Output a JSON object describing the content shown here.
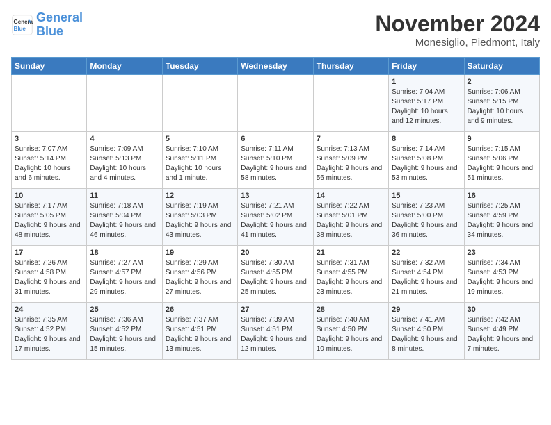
{
  "header": {
    "logo_line1": "General",
    "logo_line2": "Blue",
    "month": "November 2024",
    "location": "Monesiglio, Piedmont, Italy"
  },
  "days_of_week": [
    "Sunday",
    "Monday",
    "Tuesday",
    "Wednesday",
    "Thursday",
    "Friday",
    "Saturday"
  ],
  "weeks": [
    [
      {
        "num": "",
        "info": ""
      },
      {
        "num": "",
        "info": ""
      },
      {
        "num": "",
        "info": ""
      },
      {
        "num": "",
        "info": ""
      },
      {
        "num": "",
        "info": ""
      },
      {
        "num": "1",
        "info": "Sunrise: 7:04 AM\nSunset: 5:17 PM\nDaylight: 10 hours and 12 minutes."
      },
      {
        "num": "2",
        "info": "Sunrise: 7:06 AM\nSunset: 5:15 PM\nDaylight: 10 hours and 9 minutes."
      }
    ],
    [
      {
        "num": "3",
        "info": "Sunrise: 7:07 AM\nSunset: 5:14 PM\nDaylight: 10 hours and 6 minutes."
      },
      {
        "num": "4",
        "info": "Sunrise: 7:09 AM\nSunset: 5:13 PM\nDaylight: 10 hours and 4 minutes."
      },
      {
        "num": "5",
        "info": "Sunrise: 7:10 AM\nSunset: 5:11 PM\nDaylight: 10 hours and 1 minute."
      },
      {
        "num": "6",
        "info": "Sunrise: 7:11 AM\nSunset: 5:10 PM\nDaylight: 9 hours and 58 minutes."
      },
      {
        "num": "7",
        "info": "Sunrise: 7:13 AM\nSunset: 5:09 PM\nDaylight: 9 hours and 56 minutes."
      },
      {
        "num": "8",
        "info": "Sunrise: 7:14 AM\nSunset: 5:08 PM\nDaylight: 9 hours and 53 minutes."
      },
      {
        "num": "9",
        "info": "Sunrise: 7:15 AM\nSunset: 5:06 PM\nDaylight: 9 hours and 51 minutes."
      }
    ],
    [
      {
        "num": "10",
        "info": "Sunrise: 7:17 AM\nSunset: 5:05 PM\nDaylight: 9 hours and 48 minutes."
      },
      {
        "num": "11",
        "info": "Sunrise: 7:18 AM\nSunset: 5:04 PM\nDaylight: 9 hours and 46 minutes."
      },
      {
        "num": "12",
        "info": "Sunrise: 7:19 AM\nSunset: 5:03 PM\nDaylight: 9 hours and 43 minutes."
      },
      {
        "num": "13",
        "info": "Sunrise: 7:21 AM\nSunset: 5:02 PM\nDaylight: 9 hours and 41 minutes."
      },
      {
        "num": "14",
        "info": "Sunrise: 7:22 AM\nSunset: 5:01 PM\nDaylight: 9 hours and 38 minutes."
      },
      {
        "num": "15",
        "info": "Sunrise: 7:23 AM\nSunset: 5:00 PM\nDaylight: 9 hours and 36 minutes."
      },
      {
        "num": "16",
        "info": "Sunrise: 7:25 AM\nSunset: 4:59 PM\nDaylight: 9 hours and 34 minutes."
      }
    ],
    [
      {
        "num": "17",
        "info": "Sunrise: 7:26 AM\nSunset: 4:58 PM\nDaylight: 9 hours and 31 minutes."
      },
      {
        "num": "18",
        "info": "Sunrise: 7:27 AM\nSunset: 4:57 PM\nDaylight: 9 hours and 29 minutes."
      },
      {
        "num": "19",
        "info": "Sunrise: 7:29 AM\nSunset: 4:56 PM\nDaylight: 9 hours and 27 minutes."
      },
      {
        "num": "20",
        "info": "Sunrise: 7:30 AM\nSunset: 4:55 PM\nDaylight: 9 hours and 25 minutes."
      },
      {
        "num": "21",
        "info": "Sunrise: 7:31 AM\nSunset: 4:55 PM\nDaylight: 9 hours and 23 minutes."
      },
      {
        "num": "22",
        "info": "Sunrise: 7:32 AM\nSunset: 4:54 PM\nDaylight: 9 hours and 21 minutes."
      },
      {
        "num": "23",
        "info": "Sunrise: 7:34 AM\nSunset: 4:53 PM\nDaylight: 9 hours and 19 minutes."
      }
    ],
    [
      {
        "num": "24",
        "info": "Sunrise: 7:35 AM\nSunset: 4:52 PM\nDaylight: 9 hours and 17 minutes."
      },
      {
        "num": "25",
        "info": "Sunrise: 7:36 AM\nSunset: 4:52 PM\nDaylight: 9 hours and 15 minutes."
      },
      {
        "num": "26",
        "info": "Sunrise: 7:37 AM\nSunset: 4:51 PM\nDaylight: 9 hours and 13 minutes."
      },
      {
        "num": "27",
        "info": "Sunrise: 7:39 AM\nSunset: 4:51 PM\nDaylight: 9 hours and 12 minutes."
      },
      {
        "num": "28",
        "info": "Sunrise: 7:40 AM\nSunset: 4:50 PM\nDaylight: 9 hours and 10 minutes."
      },
      {
        "num": "29",
        "info": "Sunrise: 7:41 AM\nSunset: 4:50 PM\nDaylight: 9 hours and 8 minutes."
      },
      {
        "num": "30",
        "info": "Sunrise: 7:42 AM\nSunset: 4:49 PM\nDaylight: 9 hours and 7 minutes."
      }
    ]
  ]
}
